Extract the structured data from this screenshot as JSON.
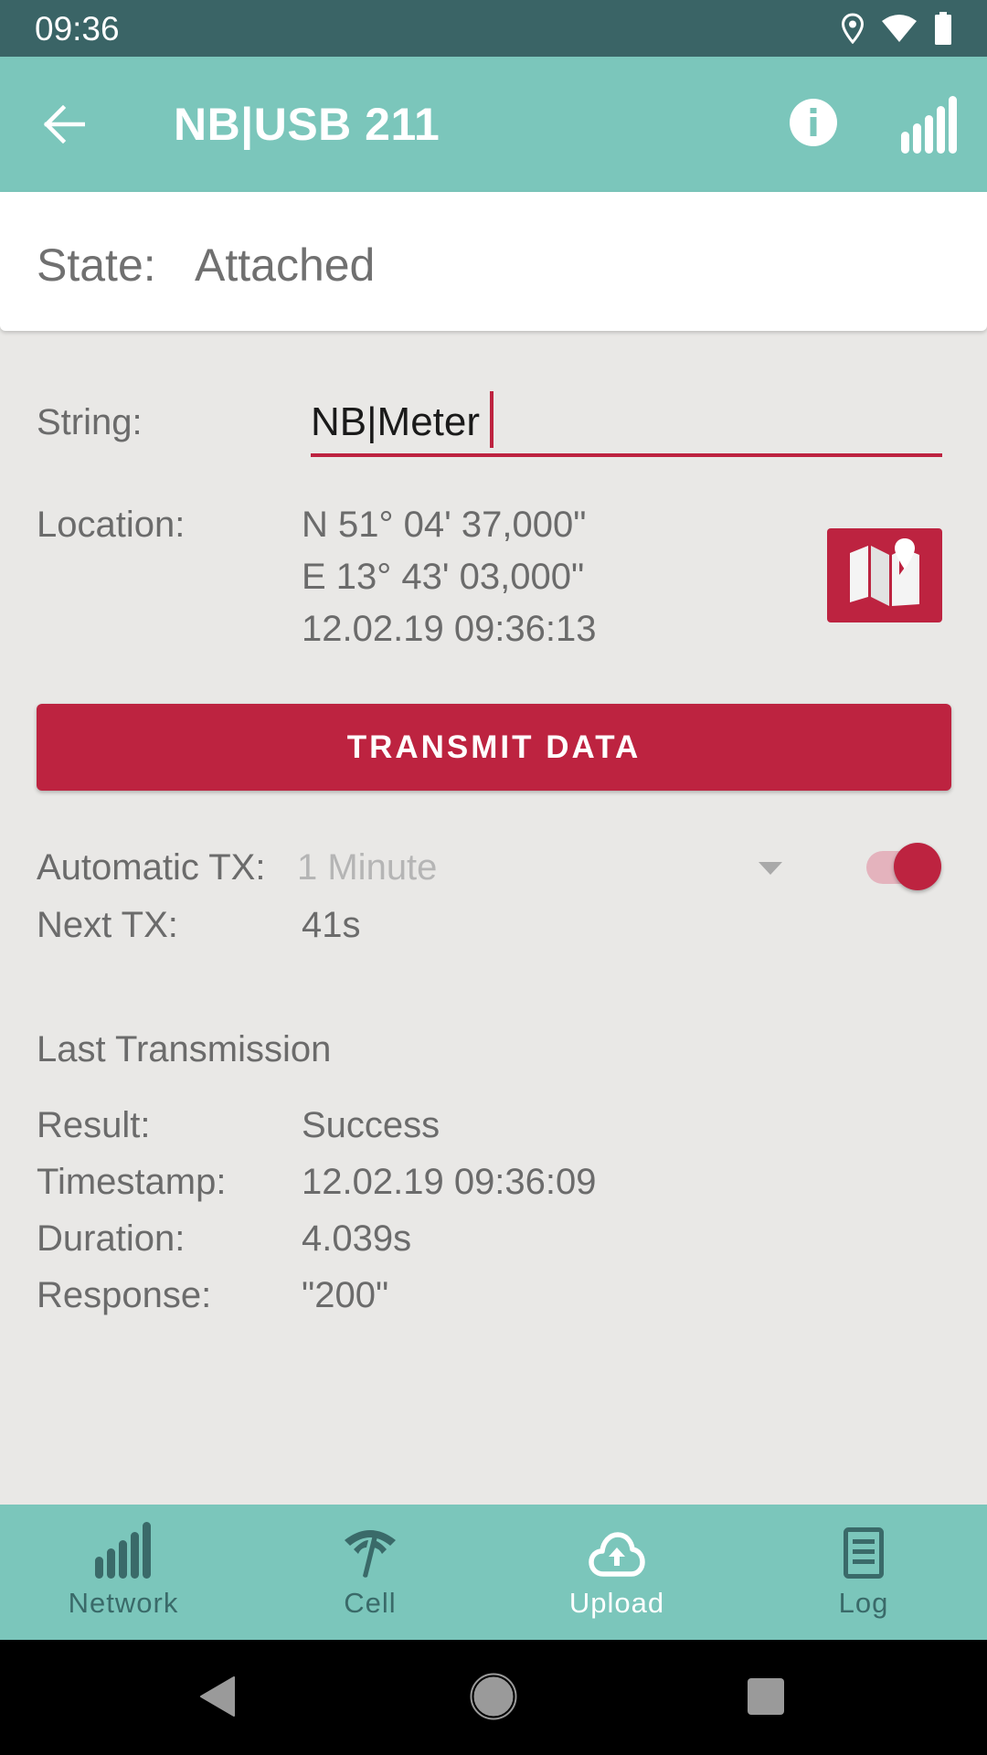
{
  "status_bar": {
    "time": "09:36",
    "icons": [
      "location-icon",
      "wifi-icon",
      "battery-icon"
    ]
  },
  "app_bar": {
    "title": "NB|USB 211",
    "back_icon": "arrow-left-icon",
    "info_icon": "info-icon",
    "signal_icon": "signal-bars-icon"
  },
  "state": {
    "label": "State:",
    "value": "Attached"
  },
  "form": {
    "string": {
      "label": "String:",
      "value": "NB|Meter"
    },
    "location": {
      "label": "Location:",
      "latitude": "N 51° 04' 37,000\"",
      "longitude": "E 13° 43' 03,000\"",
      "timestamp": "12.02.19 09:36:13",
      "map_button_icon": "map-pin-icon"
    },
    "transmit_button": "TRANSMIT DATA",
    "automatic_tx": {
      "label": "Automatic TX:",
      "selected": "1 Minute",
      "enabled": true
    },
    "next_tx": {
      "label": "Next TX:",
      "value": "41s"
    }
  },
  "last_transmission": {
    "title": "Last Transmission",
    "rows": [
      {
        "label": "Result:",
        "value": "Success"
      },
      {
        "label": "Timestamp:",
        "value": "12.02.19 09:36:09"
      },
      {
        "label": "Duration:",
        "value": "4.039s"
      },
      {
        "label": "Response:",
        "value": "\"200\""
      }
    ]
  },
  "bottom_nav": {
    "items": [
      {
        "label": "Network",
        "icon": "signal-bars-icon",
        "active": false
      },
      {
        "label": "Cell",
        "icon": "cell-tower-icon",
        "active": false
      },
      {
        "label": "Upload",
        "icon": "cloud-upload-icon",
        "active": true
      },
      {
        "label": "Log",
        "icon": "document-list-icon",
        "active": false
      }
    ]
  },
  "colors": {
    "status_bar": "#3A6466",
    "primary": "#7BC6BB",
    "accent": "#BD2340",
    "background": "#E9E8E6",
    "text": "#6B6B6B",
    "nav_inactive": "#3A6A69"
  }
}
